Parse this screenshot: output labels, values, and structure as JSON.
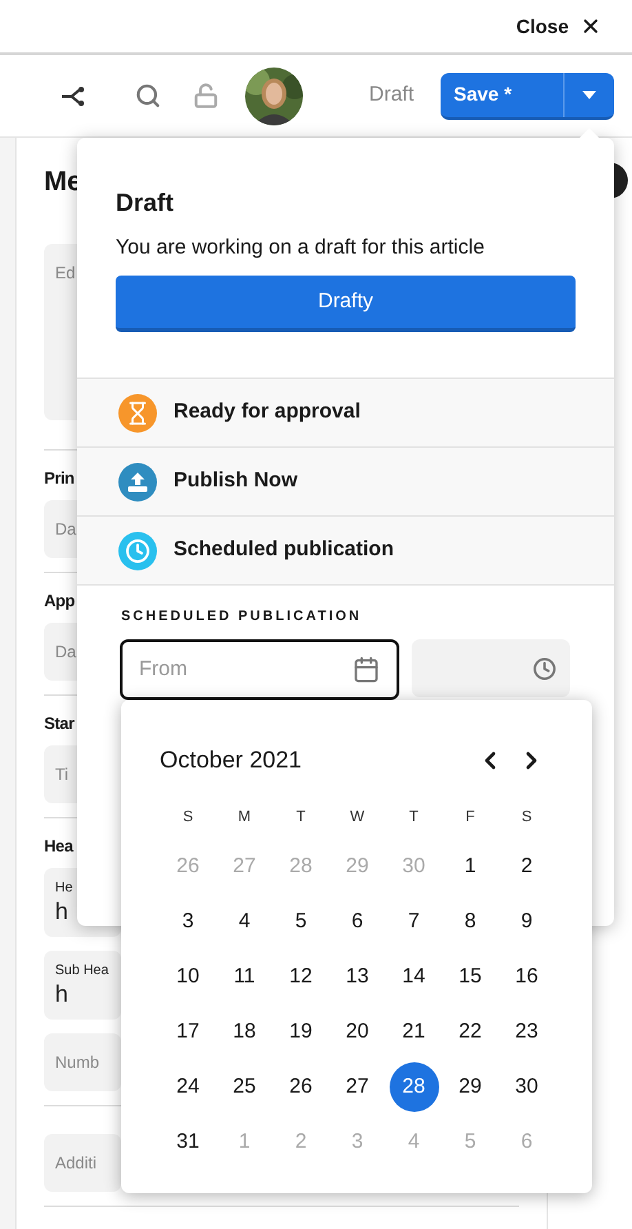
{
  "top_bar": {
    "close_label": "Close"
  },
  "toolbar": {
    "status": "Draft",
    "save_label": "Save *"
  },
  "form": {
    "heading": "Me",
    "sections": [
      {
        "fields": [
          {
            "kind": "textarea",
            "placeholder": "Ed"
          }
        ]
      },
      {
        "label": "Prin",
        "fields": [
          {
            "kind": "input",
            "placeholder": "Da"
          }
        ]
      },
      {
        "label": "App",
        "fields": [
          {
            "kind": "input",
            "placeholder": "Da"
          }
        ]
      },
      {
        "label": "Star",
        "fields": [
          {
            "kind": "input",
            "placeholder": "Ti"
          }
        ]
      },
      {
        "label": "Hea",
        "fields": [
          {
            "kind": "labeled",
            "label": "He",
            "value": "h"
          },
          {
            "kind": "labeled",
            "label": "Sub Hea",
            "value": "h"
          },
          {
            "kind": "input",
            "placeholder": "Numb"
          }
        ]
      },
      {
        "fields": [
          {
            "kind": "input",
            "placeholder": "Additi"
          }
        ]
      }
    ]
  },
  "status_menu": {
    "title": "Draft",
    "description": "You are working on a draft for this article",
    "button": "Drafty",
    "options": [
      {
        "kind": "approval",
        "label": "Ready for approval",
        "color": "#f7962b"
      },
      {
        "kind": "publish",
        "label": "Publish Now",
        "color": "#2f8dc0"
      },
      {
        "kind": "schedule",
        "label": "Scheduled publication",
        "color": "#29c0ee"
      }
    ],
    "schedule_label": "SCHEDULED PUBLICATION",
    "date_placeholder": "From"
  },
  "calendar": {
    "month": "October 2021",
    "weekdays": [
      "S",
      "M",
      "T",
      "W",
      "T",
      "F",
      "S"
    ],
    "weeks": [
      [
        {
          "label": "26",
          "outside": true,
          "selected": false
        },
        {
          "label": "27",
          "outside": true,
          "selected": false
        },
        {
          "label": "28",
          "outside": true,
          "selected": false
        },
        {
          "label": "29",
          "outside": true,
          "selected": false
        },
        {
          "label": "30",
          "outside": true,
          "selected": false
        },
        {
          "label": "1",
          "outside": false,
          "selected": false
        },
        {
          "label": "2",
          "outside": false,
          "selected": false
        }
      ],
      [
        {
          "label": "3",
          "outside": false,
          "selected": false
        },
        {
          "label": "4",
          "outside": false,
          "selected": false
        },
        {
          "label": "5",
          "outside": false,
          "selected": false
        },
        {
          "label": "6",
          "outside": false,
          "selected": false
        },
        {
          "label": "7",
          "outside": false,
          "selected": false
        },
        {
          "label": "8",
          "outside": false,
          "selected": false
        },
        {
          "label": "9",
          "outside": false,
          "selected": false
        }
      ],
      [
        {
          "label": "10",
          "outside": false,
          "selected": false
        },
        {
          "label": "11",
          "outside": false,
          "selected": false
        },
        {
          "label": "12",
          "outside": false,
          "selected": false
        },
        {
          "label": "13",
          "outside": false,
          "selected": false
        },
        {
          "label": "14",
          "outside": false,
          "selected": false
        },
        {
          "label": "15",
          "outside": false,
          "selected": false
        },
        {
          "label": "16",
          "outside": false,
          "selected": false
        }
      ],
      [
        {
          "label": "17",
          "outside": false,
          "selected": false
        },
        {
          "label": "18",
          "outside": false,
          "selected": false
        },
        {
          "label": "19",
          "outside": false,
          "selected": false
        },
        {
          "label": "20",
          "outside": false,
          "selected": false
        },
        {
          "label": "21",
          "outside": false,
          "selected": false
        },
        {
          "label": "22",
          "outside": false,
          "selected": false
        },
        {
          "label": "23",
          "outside": false,
          "selected": false
        }
      ],
      [
        {
          "label": "24",
          "outside": false,
          "selected": false
        },
        {
          "label": "25",
          "outside": false,
          "selected": false
        },
        {
          "label": "26",
          "outside": false,
          "selected": false
        },
        {
          "label": "27",
          "outside": false,
          "selected": false
        },
        {
          "label": "28",
          "outside": false,
          "selected": true
        },
        {
          "label": "29",
          "outside": false,
          "selected": false
        },
        {
          "label": "30",
          "outside": false,
          "selected": false
        }
      ],
      [
        {
          "label": "31",
          "outside": false,
          "selected": false
        },
        {
          "label": "1",
          "outside": true,
          "selected": false
        },
        {
          "label": "2",
          "outside": true,
          "selected": false
        },
        {
          "label": "3",
          "outside": true,
          "selected": false
        },
        {
          "label": "4",
          "outside": true,
          "selected": false
        },
        {
          "label": "5",
          "outside": true,
          "selected": false
        },
        {
          "label": "6",
          "outside": true,
          "selected": false
        }
      ]
    ]
  }
}
